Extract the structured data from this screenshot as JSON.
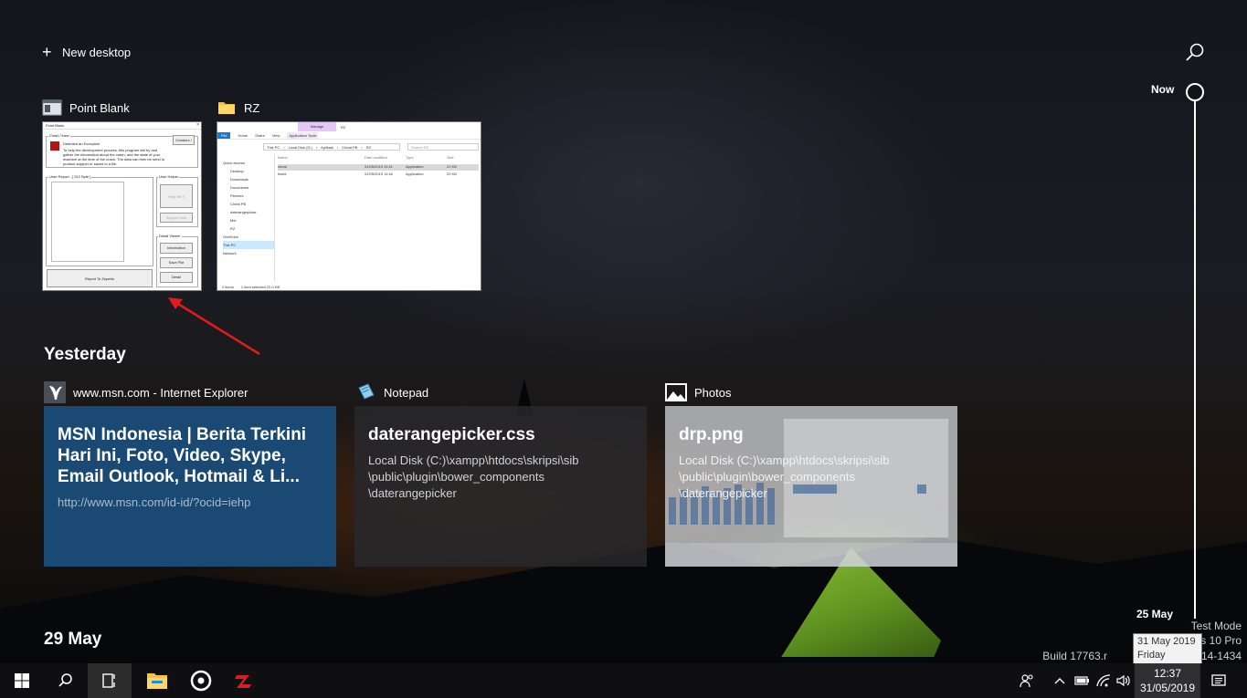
{
  "header": {
    "new_desktop_label": "New desktop"
  },
  "open_windows": [
    {
      "title": "Point Blank",
      "icon": "app-window-icon",
      "thumbnail": {
        "window_caption": "Point Blank",
        "crash_trace_label": "Crash Trace",
        "exception_text": "Detected an Exception",
        "description": "To help the development process, this program will try and gather the information about the crash, and the state of your machine at the time of the crash. The data can then be send to product support or saved to a file.",
        "creators_button": "Creators !",
        "user_report_label": "User Report - [ 512 Byte ]",
        "user_helper_label": "User Helper",
        "help_me_button": "Help Me !!",
        "support_link_button": "Support Link",
        "detail_viewer_label": "Detail Viewer",
        "information_button": "Information",
        "save_file_button": "Save File",
        "detail_button": "Detail",
        "report_button": "Report To Zepetto"
      }
    },
    {
      "title": "RZ",
      "icon": "folder-icon",
      "thumbnail": {
        "manage_tab": "Manage",
        "rz_tab": "RZ",
        "ribbon_tabs": [
          "File",
          "Home",
          "Share",
          "View",
          "Application Tools"
        ],
        "path": [
          "This PC",
          "Local Disk (D:)",
          "Aplikasi",
          "Cheat PB",
          "RZ"
        ],
        "search_placeholder": "Search RZ",
        "nav_items": [
          "Quick access",
          "Desktop",
          "Downloads",
          "Documents",
          "Pictures",
          "Cheat PB",
          "daterangepicker",
          "Mei",
          "RZ",
          "OneDrive",
          "This PC",
          "Network"
        ],
        "columns": [
          "Name",
          "Date modified",
          "Type",
          "Size"
        ],
        "files": [
          {
            "name": "cheat",
            "date": "31/05/2019 11:41",
            "type": "Application",
            "size": "22 KB"
          },
          {
            "name": "fwold",
            "date": "31/05/2019 11:46",
            "type": "Application",
            "size": "22 KB"
          }
        ],
        "status_items": "2 items",
        "status_selected": "1 item selected  22,0 KB"
      }
    }
  ],
  "sections": {
    "yesterday": "Yesterday",
    "may29": "29 May"
  },
  "timeline_cards": [
    {
      "app": "www.msn.com - Internet Explorer",
      "icon": "internet-explorer-icon",
      "title": "MSN Indonesia | Berita Terkini Hari Ini, Foto, Video, Skype, Email Outlook, Hotmail & Li...",
      "subtitle": "http://www.msn.com/id-id/?ocid=iehp"
    },
    {
      "app": "Notepad",
      "icon": "notepad-icon",
      "title": "daterangepicker.css",
      "subtitle": "Local Disk (C:)\\xampp\\htdocs\\skripsi\\sib \\public\\plugin\\bower_components \\daterangepicker"
    },
    {
      "app": "Photos",
      "icon": "photos-icon",
      "title": "drp.png",
      "subtitle": "Local Disk (C:)\\xampp\\htdocs\\skripsi\\sib \\public\\plugin\\bower_components \\daterangepicker"
    }
  ],
  "timeline": {
    "now_label": "Now",
    "end_label": "25 May"
  },
  "watermark": {
    "line1": "Test Mode",
    "line2": "ws 10 Pro",
    "line3": "Build 17763.r",
    "line3_end": "014-1434"
  },
  "tooltip": {
    "date": "31 May 2019",
    "day": "Friday"
  },
  "taskbar": {
    "time": "12:37",
    "date": "31/05/2019"
  },
  "colors": {
    "accent_card": "#1a4a74",
    "arrow": "#e01b1b"
  }
}
